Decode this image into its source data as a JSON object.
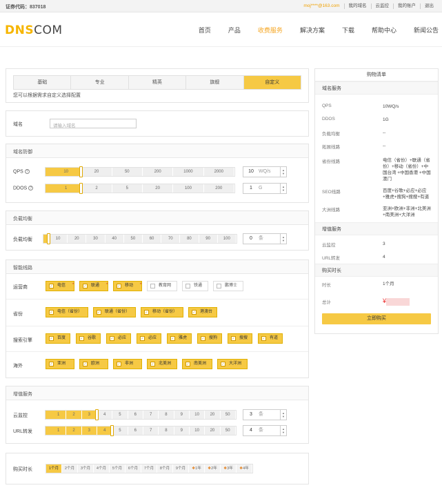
{
  "topbar": {
    "stock": "证券代码：837018",
    "links": [
      "moj****@163.com",
      "我的域名",
      "云监控",
      "我的账户",
      "退出"
    ]
  },
  "header": {
    "logo_a": "DNS",
    "logo_b": "COM",
    "nav": [
      "首页",
      "产品",
      "收费服务",
      "解决方案",
      "下载",
      "帮助中心",
      "新闻公告"
    ],
    "nav_active": 2
  },
  "tabs": [
    "基础",
    "专业",
    "精英",
    "旗舰",
    "自定义"
  ],
  "tabs_active": 4,
  "hint": "您可以根据需求自定义选择配置",
  "domain": {
    "label": "域名",
    "placeholder": "请输入域名"
  },
  "protection": {
    "title": "域名防御",
    "qps": {
      "label": "QPS",
      "ticks": [
        "10",
        "20",
        "50",
        "200",
        "1000",
        "2000"
      ],
      "level": 1,
      "value": "10",
      "unit": "WQ/s"
    },
    "ddos": {
      "label": "DDOS",
      "ticks": [
        "1",
        "2",
        "5",
        "20",
        "100",
        "200"
      ],
      "level": 1,
      "value": "1",
      "unit": "G"
    }
  },
  "balance": {
    "title": "负载均衡",
    "label": "负载均衡",
    "ticks": [
      "10",
      "20",
      "30",
      "40",
      "50",
      "60",
      "70",
      "80",
      "90",
      "100"
    ],
    "level": 0,
    "value": "0",
    "unit": "条"
  },
  "routing": {
    "title": "智能线路",
    "isp": {
      "label": "运营商",
      "items": [
        "电信",
        "联通",
        "移动",
        "教育网",
        "铁通",
        "鹏博士"
      ],
      "checked": [
        true,
        true,
        true,
        false,
        false,
        false
      ],
      "tags": [
        "★",
        "★",
        "★",
        "",
        "",
        ""
      ]
    },
    "province": {
      "label": "省份",
      "items": [
        "电信（省份）",
        "联通（省份）",
        "移动（省份）",
        "港澳台"
      ],
      "checked": [
        true,
        true,
        true,
        true
      ]
    },
    "engine": {
      "label": "搜索引擎",
      "items": [
        "百度",
        "谷歌",
        "必应",
        "必应",
        "雅虎",
        "搜狗",
        "搜搜",
        "有道"
      ],
      "checked": [
        true,
        true,
        true,
        true,
        true,
        true,
        true,
        true
      ]
    },
    "overseas": {
      "label": "海外",
      "items": [
        "亚洲",
        "欧洲",
        "非洲",
        "北美洲",
        "南美洲",
        "大洋洲"
      ],
      "checked": [
        true,
        true,
        true,
        true,
        true,
        true
      ]
    }
  },
  "addon": {
    "title": "增值服务",
    "monitor": {
      "label": "云监控",
      "ticks": [
        "1",
        "2",
        "3",
        "4",
        "5",
        "6",
        "7",
        "8",
        "9",
        "10",
        "20",
        "50"
      ],
      "level": 3,
      "value": "3",
      "unit": "条"
    },
    "url": {
      "label": "URL转发",
      "ticks": [
        "1",
        "2",
        "3",
        "4",
        "5",
        "6",
        "7",
        "8",
        "9",
        "10",
        "20",
        "50"
      ],
      "level": 4,
      "value": "4",
      "unit": "条"
    }
  },
  "duration": {
    "label": "购买时长",
    "items": [
      "1个月",
      "2个月",
      "3个月",
      "4个月",
      "5个月",
      "6个月",
      "7个月",
      "8个月",
      "9个月",
      "1年",
      "2年",
      "3年",
      "4年"
    ],
    "gift": [
      false,
      false,
      false,
      false,
      false,
      false,
      false,
      false,
      false,
      true,
      true,
      true,
      true
    ],
    "selected": 0
  },
  "cart": {
    "title": "购物清单",
    "sec1": "域名服务",
    "rows1": [
      {
        "k": "QPS",
        "v": "10WQ/s"
      },
      {
        "k": "DDOS",
        "v": "1G"
      },
      {
        "k": "负载均衡",
        "v": "--"
      },
      {
        "k": "拓展线路",
        "v": "--"
      },
      {
        "k": "省份线路",
        "v": "电信（省份）+联通（省份）+移动（省份）+中国台湾 +中国香港 +中国澳门"
      },
      {
        "k": "SEO线路",
        "v": "百度+谷歌+必应+必应+雅虎+搜狗+搜搜+有道"
      },
      {
        "k": "大洲线路",
        "v": "亚洲+欧洲+非洲+北美洲+南美洲+大洋洲"
      }
    ],
    "sec2": "增值服务",
    "rows2": [
      {
        "k": "云监控",
        "v": "3"
      },
      {
        "k": "URL转发",
        "v": "4"
      }
    ],
    "sec3": "购买时长",
    "rows3": [
      {
        "k": "时长",
        "v": "1个月"
      }
    ],
    "total_label": "总计",
    "currency": "¥",
    "buy": "立即购买"
  }
}
